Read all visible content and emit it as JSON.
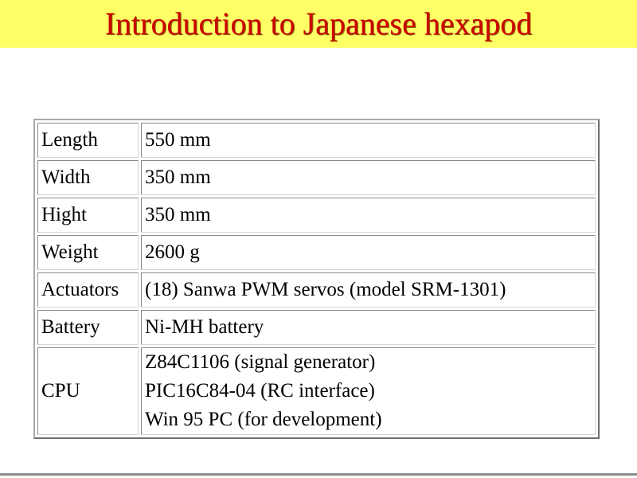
{
  "slide": {
    "title": "Introduction to Japanese hexapod",
    "title_color": "#cc0000",
    "title_bar_color": "#ffff66"
  },
  "specs": {
    "rows": [
      {
        "label": "Length",
        "value": "550 mm"
      },
      {
        "label": "Width",
        "value": "350 mm"
      },
      {
        "label": "Hight",
        "value": "350 mm"
      },
      {
        "label": "Weight",
        "value": "2600 g"
      },
      {
        "label": "Actuators",
        "value": "(18) Sanwa PWM servos (model SRM-1301)"
      },
      {
        "label": "Battery",
        "value": "Ni-MH battery"
      },
      {
        "label": "CPU",
        "lines": [
          "Z84C1106 (signal generator)",
          "PIC16C84-04 (RC interface)",
          "Win 95 PC (for development)"
        ]
      }
    ]
  }
}
